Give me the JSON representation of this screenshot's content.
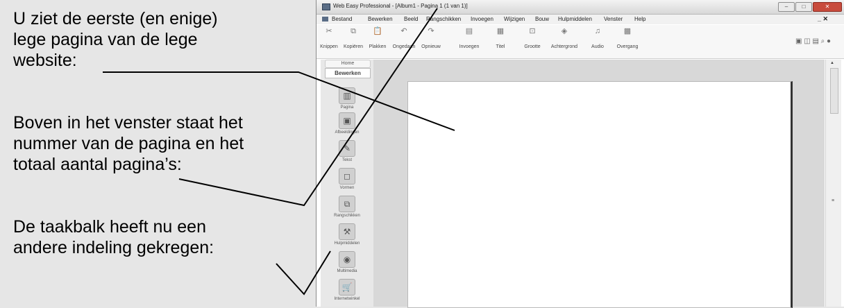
{
  "annotations": {
    "text1": [
      "U ziet de eerste (en enige)",
      "lege pagina van de lege",
      "website:"
    ],
    "text2": [
      "Boven in het venster staat het",
      "nummer van de pagina en het",
      "totaal aantal pagina’s:"
    ],
    "text3": [
      "De taakbalk heeft nu een",
      "andere indeling gekregen:"
    ]
  },
  "window": {
    "title": "Web Easy Professional - [Album1 - Pagina 1 (1 van 1)]",
    "controls": [
      "–",
      "□",
      "✕"
    ]
  },
  "menubar": {
    "items": [
      "Bestand",
      "Bewerken",
      "Beeld",
      "Rangschikken",
      "Invoegen",
      "Wijzigen",
      "Bouw",
      "Hulpmiddelen",
      "Venster",
      "Help"
    ],
    "right": "_ ✕"
  },
  "toolbar": {
    "items": [
      {
        "label": "Knippen",
        "icon": "scissors-icon",
        "glyph": "✂"
      },
      {
        "label": "Kopiëren",
        "icon": "copy-icon",
        "glyph": "⧉"
      },
      {
        "label": "Plakken",
        "icon": "paste-icon",
        "glyph": "📋"
      },
      {
        "label": "Ongedaan",
        "icon": "undo-icon",
        "glyph": "↶"
      },
      {
        "label": "Opnieuw",
        "icon": "redo-icon",
        "glyph": "↷"
      },
      {
        "label": "Invoegen",
        "icon": "insert-page-icon",
        "glyph": "▤"
      },
      {
        "label": "Titel",
        "icon": "title-icon",
        "glyph": "▦"
      },
      {
        "label": "Grootte",
        "icon": "size-icon",
        "glyph": "⊡"
      },
      {
        "label": "Achtergrond",
        "icon": "background-icon",
        "glyph": "◈"
      },
      {
        "label": "Audio",
        "icon": "audio-icon",
        "glyph": "♫"
      },
      {
        "label": "Overgang",
        "icon": "transition-icon",
        "glyph": "▩"
      }
    ],
    "right_icons": [
      "window-icon",
      "view-icon",
      "preview-icon",
      "search-icon",
      "help-icon"
    ],
    "right_glyphs": "▣ ◫ ▤ ⌕ ●"
  },
  "leftpanel": {
    "home": "Home",
    "tab": "Bewerken",
    "items": [
      {
        "label": "Pagina",
        "icon": "page-icon",
        "glyph": "▥"
      },
      {
        "label": "Afbeeldingen",
        "icon": "image-icon",
        "glyph": "▣"
      },
      {
        "label": "Tekst",
        "icon": "text-icon",
        "glyph": "✎"
      },
      {
        "label": "Vormen",
        "icon": "shapes-icon",
        "glyph": "◻"
      },
      {
        "label": "Rangschikken",
        "icon": "arrange-icon",
        "glyph": "⧉"
      },
      {
        "label": "Hulpmiddelen",
        "icon": "tools-icon",
        "glyph": "⚒"
      },
      {
        "label": "Multimedia",
        "icon": "multimedia-icon",
        "glyph": "◉"
      },
      {
        "label": "Internetwinkel",
        "icon": "shop-icon",
        "glyph": "🛒"
      }
    ]
  },
  "scrollbar": {
    "up": "▲",
    "grip": "≡"
  }
}
